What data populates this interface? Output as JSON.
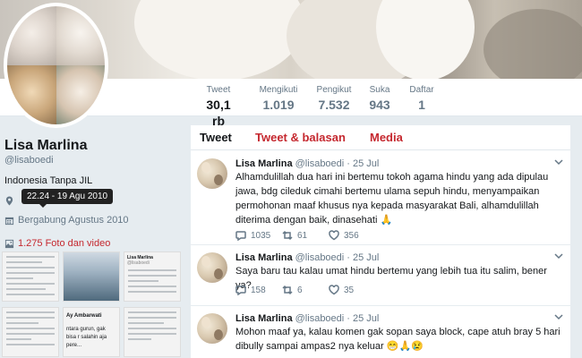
{
  "profile": {
    "name": "Lisa Marlina",
    "handle": "@lisaboedi",
    "bio": "Indonesia Tanpa JIL",
    "tooltip": "22.24 - 19 Agu 2010",
    "joined": "Bergabung Agustus 2010",
    "photos": "1.275 Foto dan video"
  },
  "stats": [
    {
      "label": "Tweet",
      "value": "30,1 rb"
    },
    {
      "label": "Mengikuti",
      "value": "1.019"
    },
    {
      "label": "Pengikut",
      "value": "7.532"
    },
    {
      "label": "Suka",
      "value": "943"
    },
    {
      "label": "Daftar",
      "value": "1"
    }
  ],
  "tabs": [
    "Tweet",
    "Tweet & balasan",
    "Media"
  ],
  "thumbnails": {
    "t1_author": "Lisa Marlina",
    "t1_handle": "@lisaboedi",
    "t2_author": "Ay Ambarwati",
    "t2_text": "ntara gurun, gak bisa r salahin aja pere..."
  },
  "tweets": [
    {
      "name": "Lisa Marlina",
      "meta": "@lisaboedi · 25 Jul",
      "text": "Alhamdulillah dua hari ini bertemu tokoh agama hindu yang ada dipulau jawa, bdg cileduk cimahi bertemu ulama sepuh hindu, menyampaikan permohonan maaf khusus nya kepada masyarakat Bali, alhamdulillah diterima dengan baik, dinasehati 🙏",
      "replies": "1035",
      "retweets": "61",
      "likes": "356"
    },
    {
      "name": "Lisa Marlina",
      "meta": "@lisaboedi · 25 Jul",
      "text": "Saya baru tau kalau umat hindu bertemu yang lebih tua itu salim, bener ya?",
      "replies": "158",
      "retweets": "6",
      "likes": "35"
    },
    {
      "name": "Lisa Marlina",
      "meta": "@lisaboedi · 25 Jul",
      "text": "Mohon maaf ya, kalau komen gak sopan saya block,  cape atuh bray 5 hari dibully sampai ampas2 nya keluar 😁🙏😢"
    }
  ],
  "colors": {
    "accent": "#c5282f",
    "text": "#14171a",
    "muted": "#657786",
    "background": "#e6ecf0"
  },
  "icons": [
    "location-icon",
    "calendar-icon",
    "photo-icon",
    "reply-icon",
    "retweet-icon",
    "like-icon",
    "chevron-down-icon"
  ]
}
